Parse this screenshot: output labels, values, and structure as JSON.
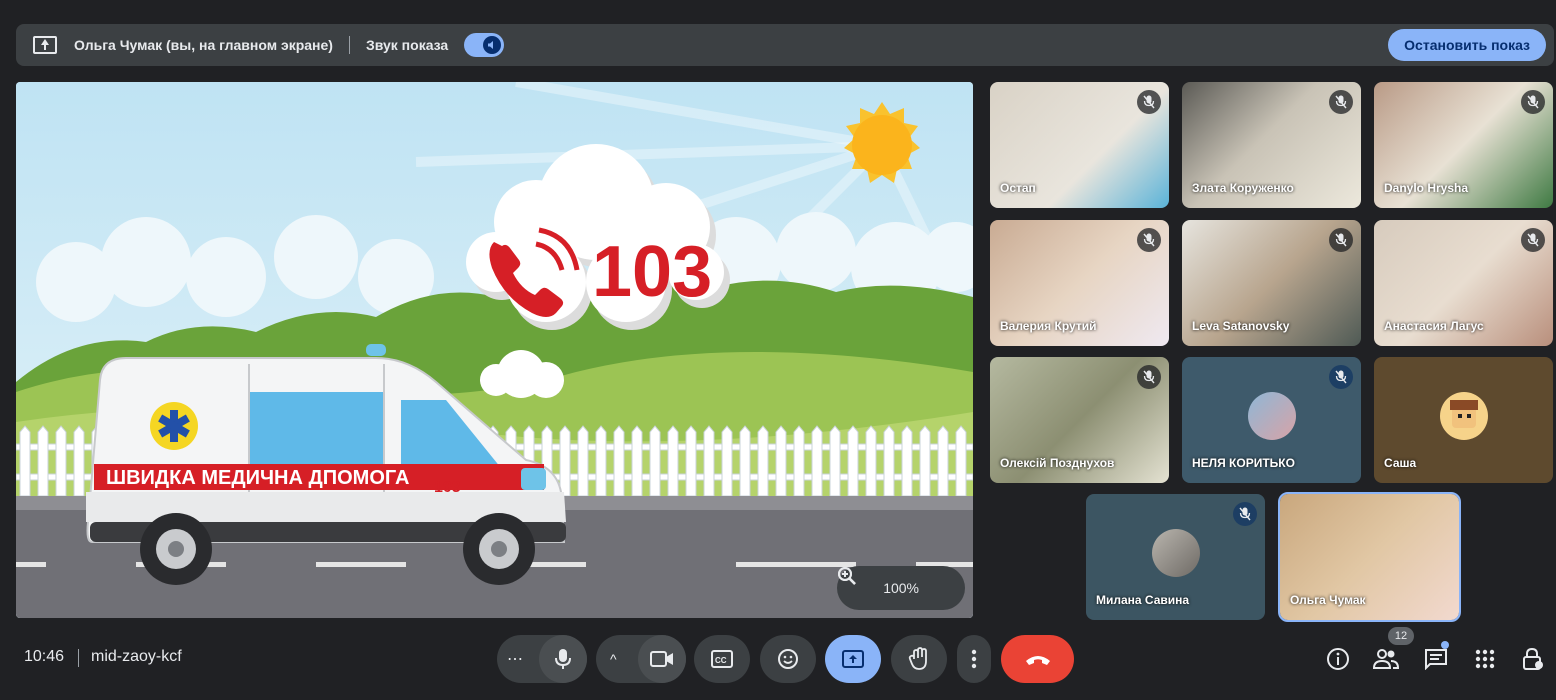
{
  "present_bar": {
    "title": "Ольга Чумак (вы, на главном экране)",
    "audio_label": "Звук показа",
    "stop_button": "Остановить показ"
  },
  "slide": {
    "phone_number": "103",
    "ambulance_text": "ШВИДКА МЕДИЧНА ДПОМОГА",
    "ambulance_number": "103"
  },
  "zoom": {
    "level": "100%"
  },
  "participants": [
    {
      "name": "Остап",
      "muted": true
    },
    {
      "name": "Злата Коруженко",
      "muted": true
    },
    {
      "name": "Danylo Hrysha",
      "muted": true
    },
    {
      "name": "Валерия Крутий",
      "muted": true
    },
    {
      "name": "Leva Satanovsky",
      "muted": true
    },
    {
      "name": "Анастасия Лагус",
      "muted": true
    },
    {
      "name": "Олексій Позднухов",
      "muted": true
    },
    {
      "name": "НЕЛЯ КОРИТЬКО",
      "muted": true
    },
    {
      "name": "Саша",
      "muted": false
    },
    {
      "name": "Милана Савина",
      "muted": true
    },
    {
      "name": "Ольга Чумак",
      "muted": false
    }
  ],
  "bottom": {
    "time": "10:46",
    "meeting_code": "mid-zaoy-kcf",
    "participants_count": "12"
  },
  "colors": {
    "accent": "#8ab4f8",
    "end_call": "#ea4335",
    "bar": "#3c4043",
    "background": "#202124"
  }
}
